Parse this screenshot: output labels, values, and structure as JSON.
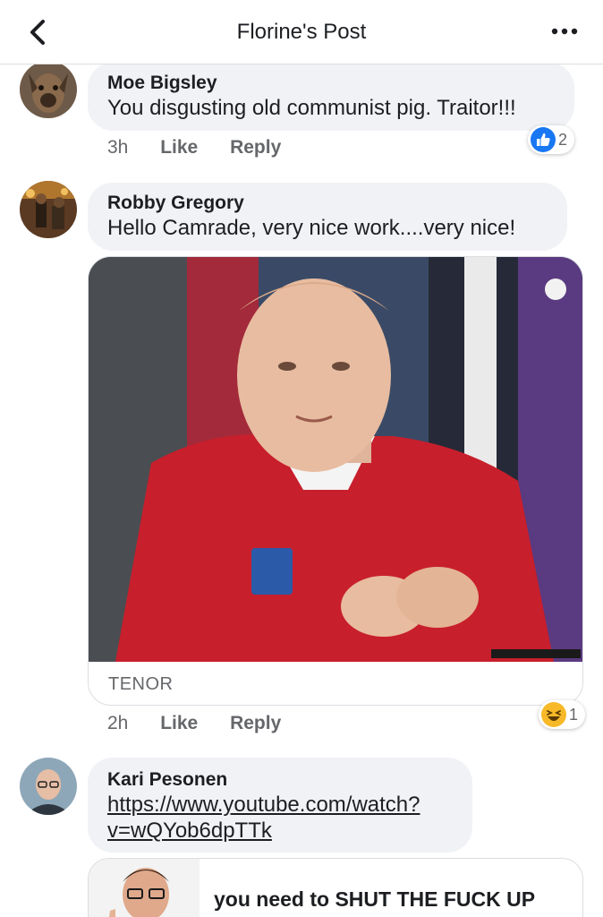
{
  "header": {
    "title": "Florine's Post",
    "back_icon": "chevron-left-icon",
    "more_icon": "more-horizontal-icon"
  },
  "comments": [
    {
      "author": "Moe Bigsley",
      "text": "You disgusting old communist pig. Traitor!!!",
      "time": "3h",
      "like_label": "Like",
      "reply_label": "Reply",
      "reaction_count": "2",
      "reaction_icon": "like-icon"
    },
    {
      "author": "Robby Gregory",
      "text": "Hello Camrade, very nice work....very nice!",
      "time": "2h",
      "like_label": "Like",
      "reply_label": "Reply",
      "reaction_count": "1",
      "reaction_icon": "haha-icon",
      "attachment_source": "TENOR"
    },
    {
      "author": "Kari Pesonen",
      "link_line1": "https://www.youtube.com/watch?",
      "link_line2": "v=wQYob6dpTTk",
      "link_preview_title": "you need to SHUT THE FUCK UP"
    }
  ],
  "colors": {
    "bubble": "#f0f2f5",
    "meta_text": "#65676b",
    "like_blue": "#1877f2",
    "haha_yellow": "#f7b928"
  }
}
